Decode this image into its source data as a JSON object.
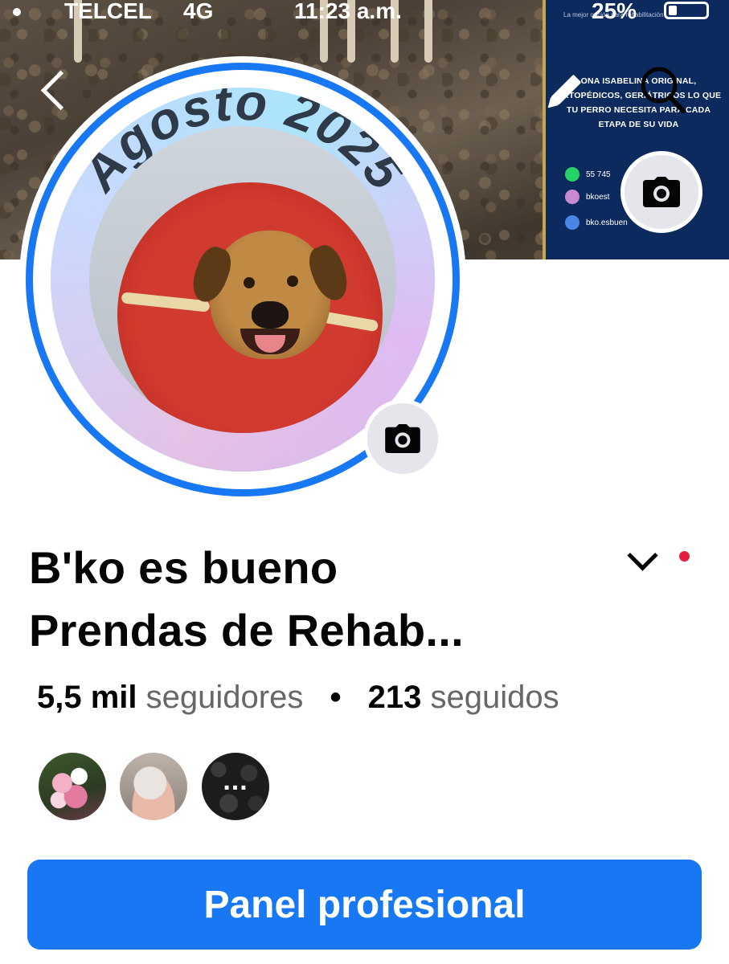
{
  "status_bar": {
    "carrier": "TELCEL",
    "network": "4G",
    "time": "11:23 a.m.",
    "battery": "25%"
  },
  "cover": {
    "ad_tagline": "La mejor opción para rehabilitación",
    "ad_text": "ONA ISABELINA ORIGINAL, ORTOPÉDICOS, GERIÁTRICOS LO QUE TU PERRO NECESITA PARA CADA ETAPA DE SU VIDA",
    "ad_phone": "55 745",
    "ad_social": "bkoest",
    "ad_email": "bko.esbuen",
    "icons": [
      "chevron-left-icon",
      "pencil-icon",
      "search-icon",
      "camera-icon"
    ]
  },
  "profile": {
    "frame_text": "Agosto 2025",
    "name_line1": "B'ko es bueno",
    "name_line2": "Prendas de Rehab...",
    "followers_count": "5,5 mil",
    "followers_label": "seguidores",
    "separator": "•",
    "following_count": "213",
    "following_label": "seguidos",
    "more_label": "..."
  },
  "actions": {
    "primary_button": "Panel profesional"
  },
  "colors": {
    "accent": "#1877f2",
    "notification_dot": "#e41e3f",
    "muted_text": "#65676b",
    "ad_background": "#0d2a5e"
  }
}
